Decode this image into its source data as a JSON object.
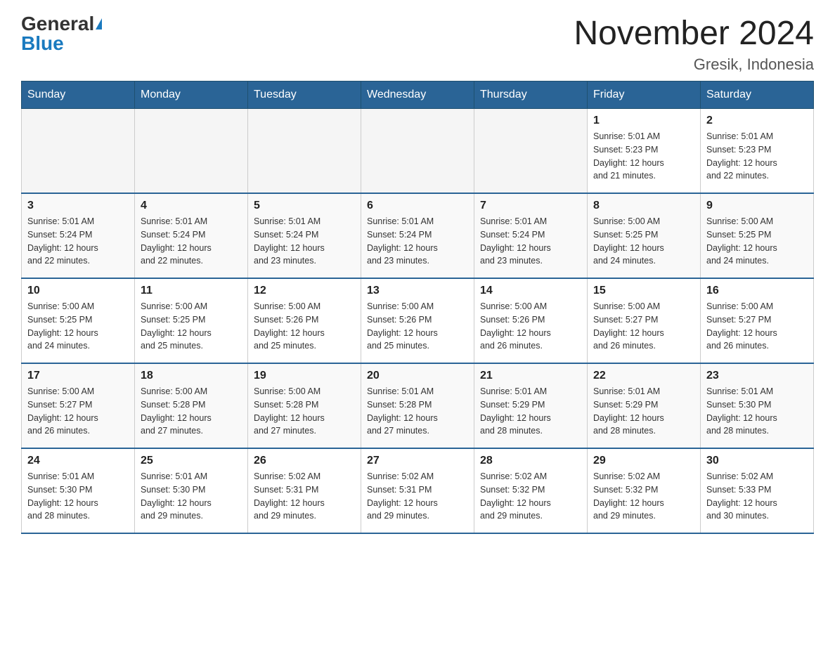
{
  "header": {
    "logo_general": "General",
    "logo_blue": "Blue",
    "title": "November 2024",
    "subtitle": "Gresik, Indonesia"
  },
  "days_of_week": [
    "Sunday",
    "Monday",
    "Tuesday",
    "Wednesday",
    "Thursday",
    "Friday",
    "Saturday"
  ],
  "weeks": [
    [
      {
        "day": "",
        "info": ""
      },
      {
        "day": "",
        "info": ""
      },
      {
        "day": "",
        "info": ""
      },
      {
        "day": "",
        "info": ""
      },
      {
        "day": "",
        "info": ""
      },
      {
        "day": "1",
        "info": "Sunrise: 5:01 AM\nSunset: 5:23 PM\nDaylight: 12 hours\nand 21 minutes."
      },
      {
        "day": "2",
        "info": "Sunrise: 5:01 AM\nSunset: 5:23 PM\nDaylight: 12 hours\nand 22 minutes."
      }
    ],
    [
      {
        "day": "3",
        "info": "Sunrise: 5:01 AM\nSunset: 5:24 PM\nDaylight: 12 hours\nand 22 minutes."
      },
      {
        "day": "4",
        "info": "Sunrise: 5:01 AM\nSunset: 5:24 PM\nDaylight: 12 hours\nand 22 minutes."
      },
      {
        "day": "5",
        "info": "Sunrise: 5:01 AM\nSunset: 5:24 PM\nDaylight: 12 hours\nand 23 minutes."
      },
      {
        "day": "6",
        "info": "Sunrise: 5:01 AM\nSunset: 5:24 PM\nDaylight: 12 hours\nand 23 minutes."
      },
      {
        "day": "7",
        "info": "Sunrise: 5:01 AM\nSunset: 5:24 PM\nDaylight: 12 hours\nand 23 minutes."
      },
      {
        "day": "8",
        "info": "Sunrise: 5:00 AM\nSunset: 5:25 PM\nDaylight: 12 hours\nand 24 minutes."
      },
      {
        "day": "9",
        "info": "Sunrise: 5:00 AM\nSunset: 5:25 PM\nDaylight: 12 hours\nand 24 minutes."
      }
    ],
    [
      {
        "day": "10",
        "info": "Sunrise: 5:00 AM\nSunset: 5:25 PM\nDaylight: 12 hours\nand 24 minutes."
      },
      {
        "day": "11",
        "info": "Sunrise: 5:00 AM\nSunset: 5:25 PM\nDaylight: 12 hours\nand 25 minutes."
      },
      {
        "day": "12",
        "info": "Sunrise: 5:00 AM\nSunset: 5:26 PM\nDaylight: 12 hours\nand 25 minutes."
      },
      {
        "day": "13",
        "info": "Sunrise: 5:00 AM\nSunset: 5:26 PM\nDaylight: 12 hours\nand 25 minutes."
      },
      {
        "day": "14",
        "info": "Sunrise: 5:00 AM\nSunset: 5:26 PM\nDaylight: 12 hours\nand 26 minutes."
      },
      {
        "day": "15",
        "info": "Sunrise: 5:00 AM\nSunset: 5:27 PM\nDaylight: 12 hours\nand 26 minutes."
      },
      {
        "day": "16",
        "info": "Sunrise: 5:00 AM\nSunset: 5:27 PM\nDaylight: 12 hours\nand 26 minutes."
      }
    ],
    [
      {
        "day": "17",
        "info": "Sunrise: 5:00 AM\nSunset: 5:27 PM\nDaylight: 12 hours\nand 26 minutes."
      },
      {
        "day": "18",
        "info": "Sunrise: 5:00 AM\nSunset: 5:28 PM\nDaylight: 12 hours\nand 27 minutes."
      },
      {
        "day": "19",
        "info": "Sunrise: 5:00 AM\nSunset: 5:28 PM\nDaylight: 12 hours\nand 27 minutes."
      },
      {
        "day": "20",
        "info": "Sunrise: 5:01 AM\nSunset: 5:28 PM\nDaylight: 12 hours\nand 27 minutes."
      },
      {
        "day": "21",
        "info": "Sunrise: 5:01 AM\nSunset: 5:29 PM\nDaylight: 12 hours\nand 28 minutes."
      },
      {
        "day": "22",
        "info": "Sunrise: 5:01 AM\nSunset: 5:29 PM\nDaylight: 12 hours\nand 28 minutes."
      },
      {
        "day": "23",
        "info": "Sunrise: 5:01 AM\nSunset: 5:30 PM\nDaylight: 12 hours\nand 28 minutes."
      }
    ],
    [
      {
        "day": "24",
        "info": "Sunrise: 5:01 AM\nSunset: 5:30 PM\nDaylight: 12 hours\nand 28 minutes."
      },
      {
        "day": "25",
        "info": "Sunrise: 5:01 AM\nSunset: 5:30 PM\nDaylight: 12 hours\nand 29 minutes."
      },
      {
        "day": "26",
        "info": "Sunrise: 5:02 AM\nSunset: 5:31 PM\nDaylight: 12 hours\nand 29 minutes."
      },
      {
        "day": "27",
        "info": "Sunrise: 5:02 AM\nSunset: 5:31 PM\nDaylight: 12 hours\nand 29 minutes."
      },
      {
        "day": "28",
        "info": "Sunrise: 5:02 AM\nSunset: 5:32 PM\nDaylight: 12 hours\nand 29 minutes."
      },
      {
        "day": "29",
        "info": "Sunrise: 5:02 AM\nSunset: 5:32 PM\nDaylight: 12 hours\nand 29 minutes."
      },
      {
        "day": "30",
        "info": "Sunrise: 5:02 AM\nSunset: 5:33 PM\nDaylight: 12 hours\nand 30 minutes."
      }
    ]
  ]
}
